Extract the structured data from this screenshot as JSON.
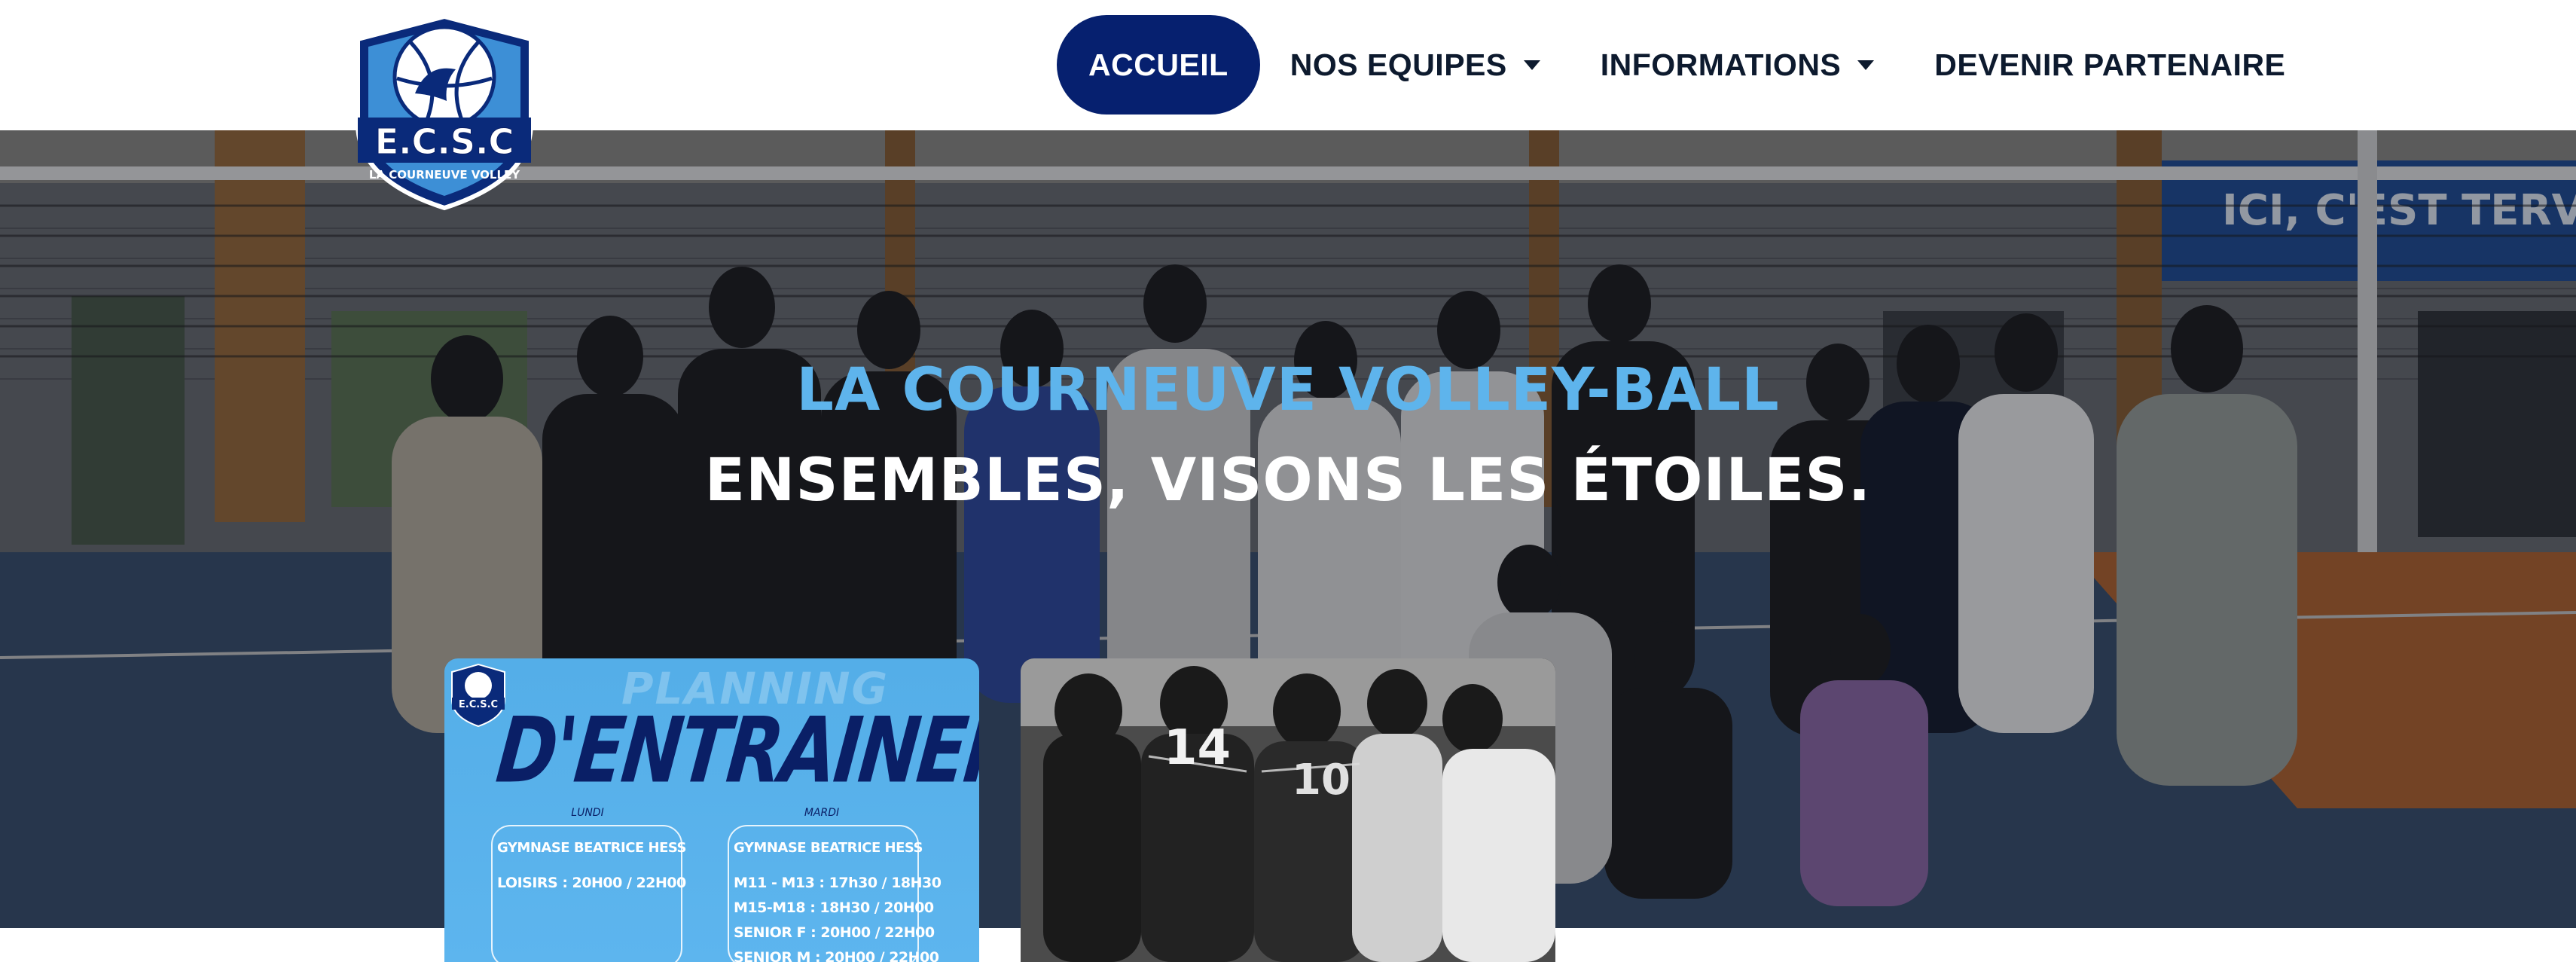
{
  "brand": {
    "logo_text": "E.C.S.C",
    "logo_subtext": "LA COURNEUVE VOLLEY",
    "primary_color": "#06206f",
    "accent_color": "#5eb4ec"
  },
  "nav": {
    "items": [
      {
        "label": "ACCUEIL",
        "active": true,
        "dropdown": false
      },
      {
        "label": "NOS EQUIPES",
        "active": false,
        "dropdown": true
      },
      {
        "label": "INFORMATIONS",
        "active": false,
        "dropdown": true
      },
      {
        "label": "DEVENIR PARTENAIRE",
        "active": false,
        "dropdown": false
      }
    ]
  },
  "hero": {
    "title": "LA COURNEUVE VOLLEY-BALL",
    "subtitle": "ENSEMBLES, VISONS LES ÉTOILES.",
    "banner_text": "ICI, C'EST TERVIL"
  },
  "cards": {
    "planning": {
      "ghost_title": "PLANNING",
      "title": "D'ENTRAINEMENT",
      "days": [
        {
          "day": "LUNDI",
          "location": "GYMNASE BEATRICE HESS",
          "slots": [
            "LOISIRS : 20H00 / 22H00"
          ]
        },
        {
          "day": "MARDI",
          "location": "GYMNASE BEATRICE HESS",
          "slots": [
            "M11 - M13 : 17h30 / 18H30",
            "M15-M18 : 18H30 / 20H00",
            "SENIOR F : 20H00 / 22H00",
            "SENIOR M : 20H00 / 22H00"
          ]
        }
      ]
    },
    "team_photo": {
      "jersey_numbers": [
        "14",
        "10"
      ]
    }
  }
}
